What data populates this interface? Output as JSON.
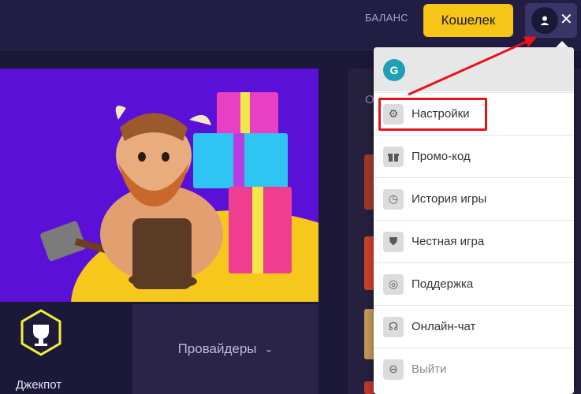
{
  "header": {
    "balance_label": "БАЛАНС",
    "wallet_label": "Кошелек",
    "close_glyph": "✕"
  },
  "right_panel": {
    "label_fragment": "О"
  },
  "bottom": {
    "jackpot_label": "Джекпот",
    "providers_label": "Провайдеры",
    "providers_chevron": "⌄"
  },
  "dropdown": {
    "user_initial": "G",
    "items": [
      {
        "label": "Настройки",
        "icon": "gear-icon",
        "glyph": "⚙"
      },
      {
        "label": "Промо-код",
        "icon": "gift-icon",
        "glyph": "🎁"
      },
      {
        "label": "История игры",
        "icon": "clock-icon",
        "glyph": "◷"
      },
      {
        "label": "Честная игра",
        "icon": "shield-icon",
        "glyph": "⛊"
      },
      {
        "label": "Поддержка",
        "icon": "lifebuoy-icon",
        "glyph": "◎"
      },
      {
        "label": "Онлайн-чат",
        "icon": "headset-icon",
        "glyph": "☊"
      },
      {
        "label": "Выйти",
        "icon": "logout-icon",
        "glyph": "⊖"
      }
    ]
  },
  "colors": {
    "accent": "#f5c518",
    "annotation": "#e8121b",
    "banner": "#5a10d6",
    "background": "#1c1838"
  }
}
